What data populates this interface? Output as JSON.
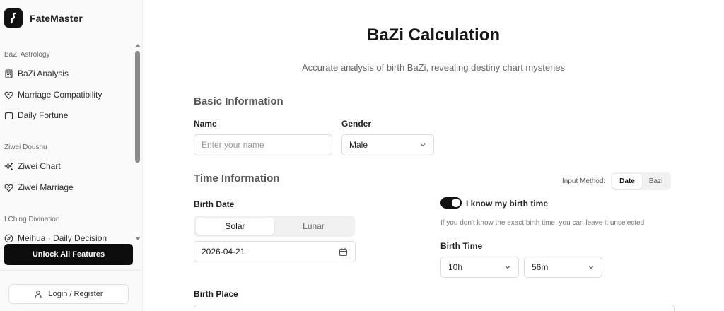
{
  "app": {
    "name": "FateMaster"
  },
  "sidebar": {
    "sections": [
      {
        "title": "BaZi Astrology",
        "items": [
          "BaZi Analysis",
          "Marriage Compatibility",
          "Daily Fortune"
        ]
      },
      {
        "title": "Ziwei Doushu",
        "items": [
          "Ziwei Chart",
          "Ziwei Marriage"
        ]
      },
      {
        "title": "I Ching Divination",
        "items": [
          "Meihua · Daily Decision"
        ]
      }
    ],
    "unlock_label": "Unlock All Features",
    "login_label": "Login / Register"
  },
  "main": {
    "title": "BaZi Calculation",
    "subtitle": "Accurate analysis of birth BaZi, revealing destiny chart mysteries",
    "basic": {
      "title": "Basic Information",
      "name_label": "Name",
      "name_placeholder": "Enter your name",
      "gender_label": "Gender",
      "gender_value": "Male"
    },
    "time": {
      "title": "Time Information",
      "input_method_label": "Input Method:",
      "input_method_options": [
        "Date",
        "Bazi"
      ],
      "input_method_selected": "Date",
      "birth_date_label": "Birth Date",
      "calendar_options": [
        "Solar",
        "Lunar"
      ],
      "calendar_selected": "Solar",
      "birth_date_value": "2026-04-21",
      "know_time_label": "I know my birth time",
      "know_time_on": true,
      "know_time_hint": "If you don't know the exact birth time, you can leave it unselected",
      "birth_time_label": "Birth Time",
      "hour_value": "10h",
      "minute_value": "56m"
    },
    "birth_place_label": "Birth Place"
  },
  "colors": {
    "accent": "#0d0d0d",
    "text": "#1f1f1f",
    "muted": "#666666",
    "border": "#dcdcdc"
  }
}
